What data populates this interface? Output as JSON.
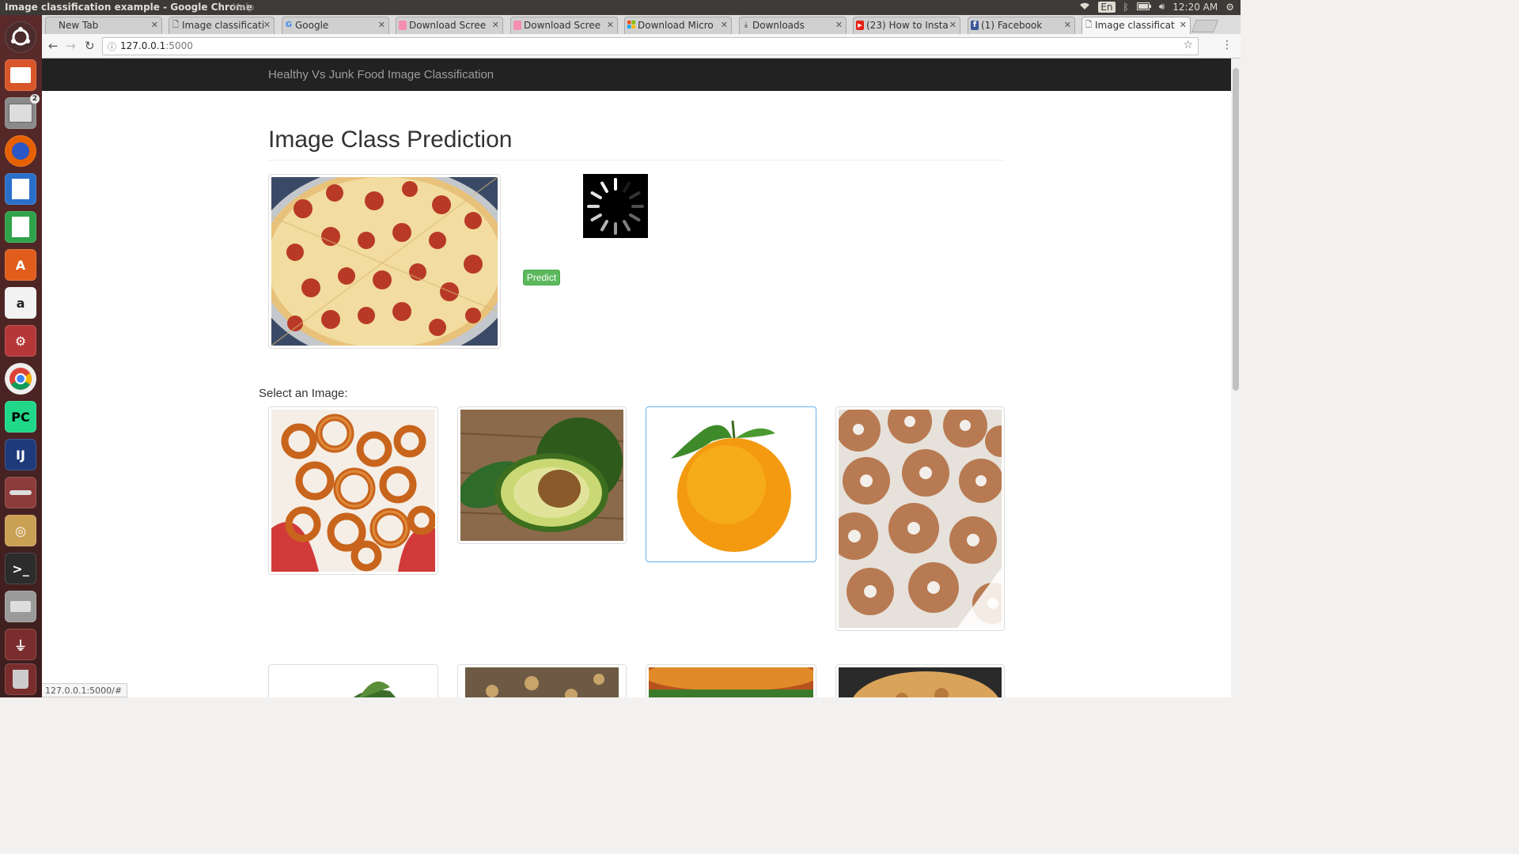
{
  "system_bar": {
    "window_title": "Image classification example - Google Chrome",
    "menu_help": "Help",
    "keyboard_layout": "En",
    "clock": "12:20 AM"
  },
  "launcher": {
    "files_badge": "2",
    "items": [
      "dash",
      "impress",
      "files",
      "firefox",
      "writer",
      "calc",
      "software-center",
      "amazon",
      "settings",
      "chrome",
      "pycharm",
      "intellij",
      "disks",
      "image-viewer",
      "terminal",
      "drive",
      "usb",
      "trash"
    ]
  },
  "tabs": [
    {
      "label": "New Tab",
      "icon": "none"
    },
    {
      "label": "Image classificati",
      "icon": "page-icon"
    },
    {
      "label": "Google",
      "icon": "google-icon"
    },
    {
      "label": "Download Scree",
      "icon": "download-page-icon"
    },
    {
      "label": "Download Scree",
      "icon": "download-page-icon"
    },
    {
      "label": "Download Micro",
      "icon": "microsoft-icon"
    },
    {
      "label": "Downloads",
      "icon": "download-icon"
    },
    {
      "label": "(23) How to Insta",
      "icon": "youtube-icon"
    },
    {
      "label": "(1) Facebook",
      "icon": "facebook-icon"
    },
    {
      "label": "Image classificat",
      "icon": "page-icon"
    }
  ],
  "address_bar": {
    "host": "127.0.0.1",
    "port": ":5000"
  },
  "page": {
    "brand": "Healthy Vs Junk Food Image Classification",
    "heading": "Image Class Prediction",
    "predict_label": "Predict",
    "select_label": "Select an Image:",
    "preview_image": "pepperoni pizza",
    "gallery": [
      {
        "name": "onion rings",
        "selected": false
      },
      {
        "name": "avocado",
        "selected": false
      },
      {
        "name": "orange",
        "selected": true
      },
      {
        "name": "glazed donuts",
        "selected": false
      },
      {
        "name": "leafy greens",
        "selected": false
      },
      {
        "name": "granola",
        "selected": false
      },
      {
        "name": "burger",
        "selected": false
      },
      {
        "name": "baked dish",
        "selected": false
      }
    ]
  },
  "status_bar": {
    "link_url": "127.0.0.1:5000/#"
  },
  "colors": {
    "navbar": "#222222",
    "predict_button": "#5cb85c",
    "selected_border": "#66afe9"
  }
}
